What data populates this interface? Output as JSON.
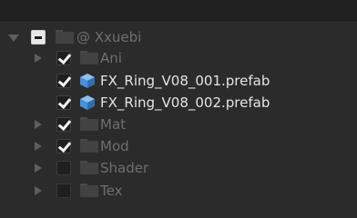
{
  "tree": {
    "root": {
      "label": "@ Xxuebi",
      "checkbox": "mixed",
      "expanded": true
    },
    "items": [
      {
        "label": "Ani",
        "checkbox": "checked",
        "type": "folder",
        "has_children": true
      },
      {
        "label": "FX_Ring_V08_001.prefab",
        "checkbox": "checked",
        "type": "prefab",
        "has_children": false
      },
      {
        "label": "FX_Ring_V08_002.prefab",
        "checkbox": "checked",
        "type": "prefab",
        "has_children": false
      },
      {
        "label": "Mat",
        "checkbox": "checked",
        "type": "folder",
        "has_children": true
      },
      {
        "label": "Mod",
        "checkbox": "checked",
        "type": "folder",
        "has_children": true
      },
      {
        "label": "Shader",
        "checkbox": "unchecked",
        "type": "folder",
        "has_children": true
      },
      {
        "label": "Tex",
        "checkbox": "unchecked",
        "type": "folder",
        "has_children": true
      }
    ]
  },
  "icons": {
    "expand": "triangle-down-icon",
    "collapse": "triangle-right-icon",
    "folder": "folder-icon",
    "prefab": "prefab-cube-icon"
  },
  "colors": {
    "background": "#2b2b2b",
    "text_dim": "#6f6f6f",
    "text_bright": "#e4e4e4",
    "cube_blue": "#4a8fd8"
  }
}
